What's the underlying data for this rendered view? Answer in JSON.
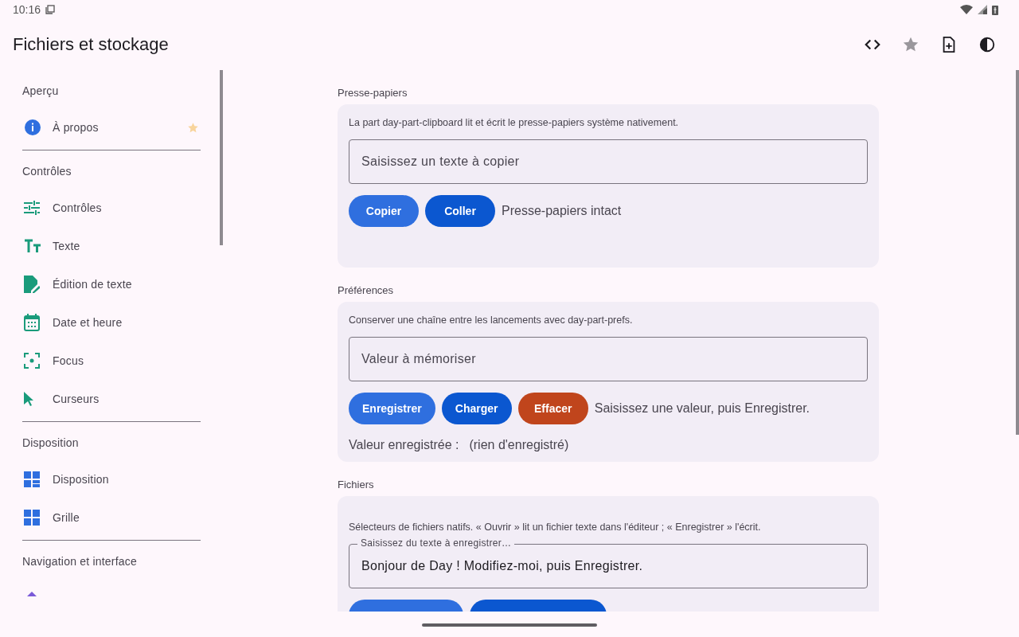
{
  "status_bar": {
    "time": "10:16"
  },
  "app_bar": {
    "title": "Fichiers et stockage"
  },
  "sidebar": {
    "sections": [
      {
        "heading": "Aperçu",
        "items": [
          {
            "label": "À propos",
            "favorite": true
          }
        ]
      },
      {
        "heading": "Contrôles",
        "items": [
          {
            "label": "Contrôles",
            "favorite": false
          },
          {
            "label": "Texte",
            "favorite": false
          },
          {
            "label": "Édition de texte",
            "favorite": false
          },
          {
            "label": "Date et heure",
            "favorite": false
          },
          {
            "label": "Focus",
            "favorite": false
          },
          {
            "label": "Curseurs",
            "favorite": false
          }
        ]
      },
      {
        "heading": "Disposition",
        "items": [
          {
            "label": "Disposition",
            "favorite": false
          },
          {
            "label": "Grille",
            "favorite": false
          }
        ]
      },
      {
        "heading": "Navigation et interface"
      }
    ]
  },
  "cards": [
    {
      "heading": "Presse-papiers",
      "description": "La part day-part-clipboard lit et écrit le presse-papiers système nativement.",
      "field": {
        "placeholder": "Saisissez un texte à copier"
      },
      "buttons": [
        {
          "label": "Copier",
          "kind": "secondary"
        },
        {
          "label": "Coller",
          "kind": "primary"
        }
      ],
      "status": "Presse-papiers intact"
    },
    {
      "heading": "Préférences",
      "description": "Conserver une chaîne entre les lancements avec day-part-prefs.",
      "field": {
        "placeholder": "Valeur à mémoriser"
      },
      "buttons": [
        {
          "label": "Enregistrer",
          "kind": "secondary"
        },
        {
          "label": "Charger",
          "kind": "primary"
        },
        {
          "label": "Effacer",
          "kind": "danger"
        }
      ],
      "status": "Saisissez une valeur, puis Enregistrer.",
      "saved": {
        "label": "Valeur enregistrée :",
        "value": "(rien d'enregistré)"
      }
    },
    {
      "heading": "Fichiers",
      "description": "Sélecteurs de fichiers natifs. « Ouvrir » lit un fichier texte dans l'éditeur ; « Enregistrer » l'écrit.",
      "field": {
        "label": "Saisissez du texte à enregistrer…",
        "value": "Bonjour de Day ! Modifiez-moi, puis Enregistrer."
      },
      "buttons": [
        {
          "kind": "secondary"
        },
        {
          "kind": "primary"
        }
      ]
    }
  ]
}
